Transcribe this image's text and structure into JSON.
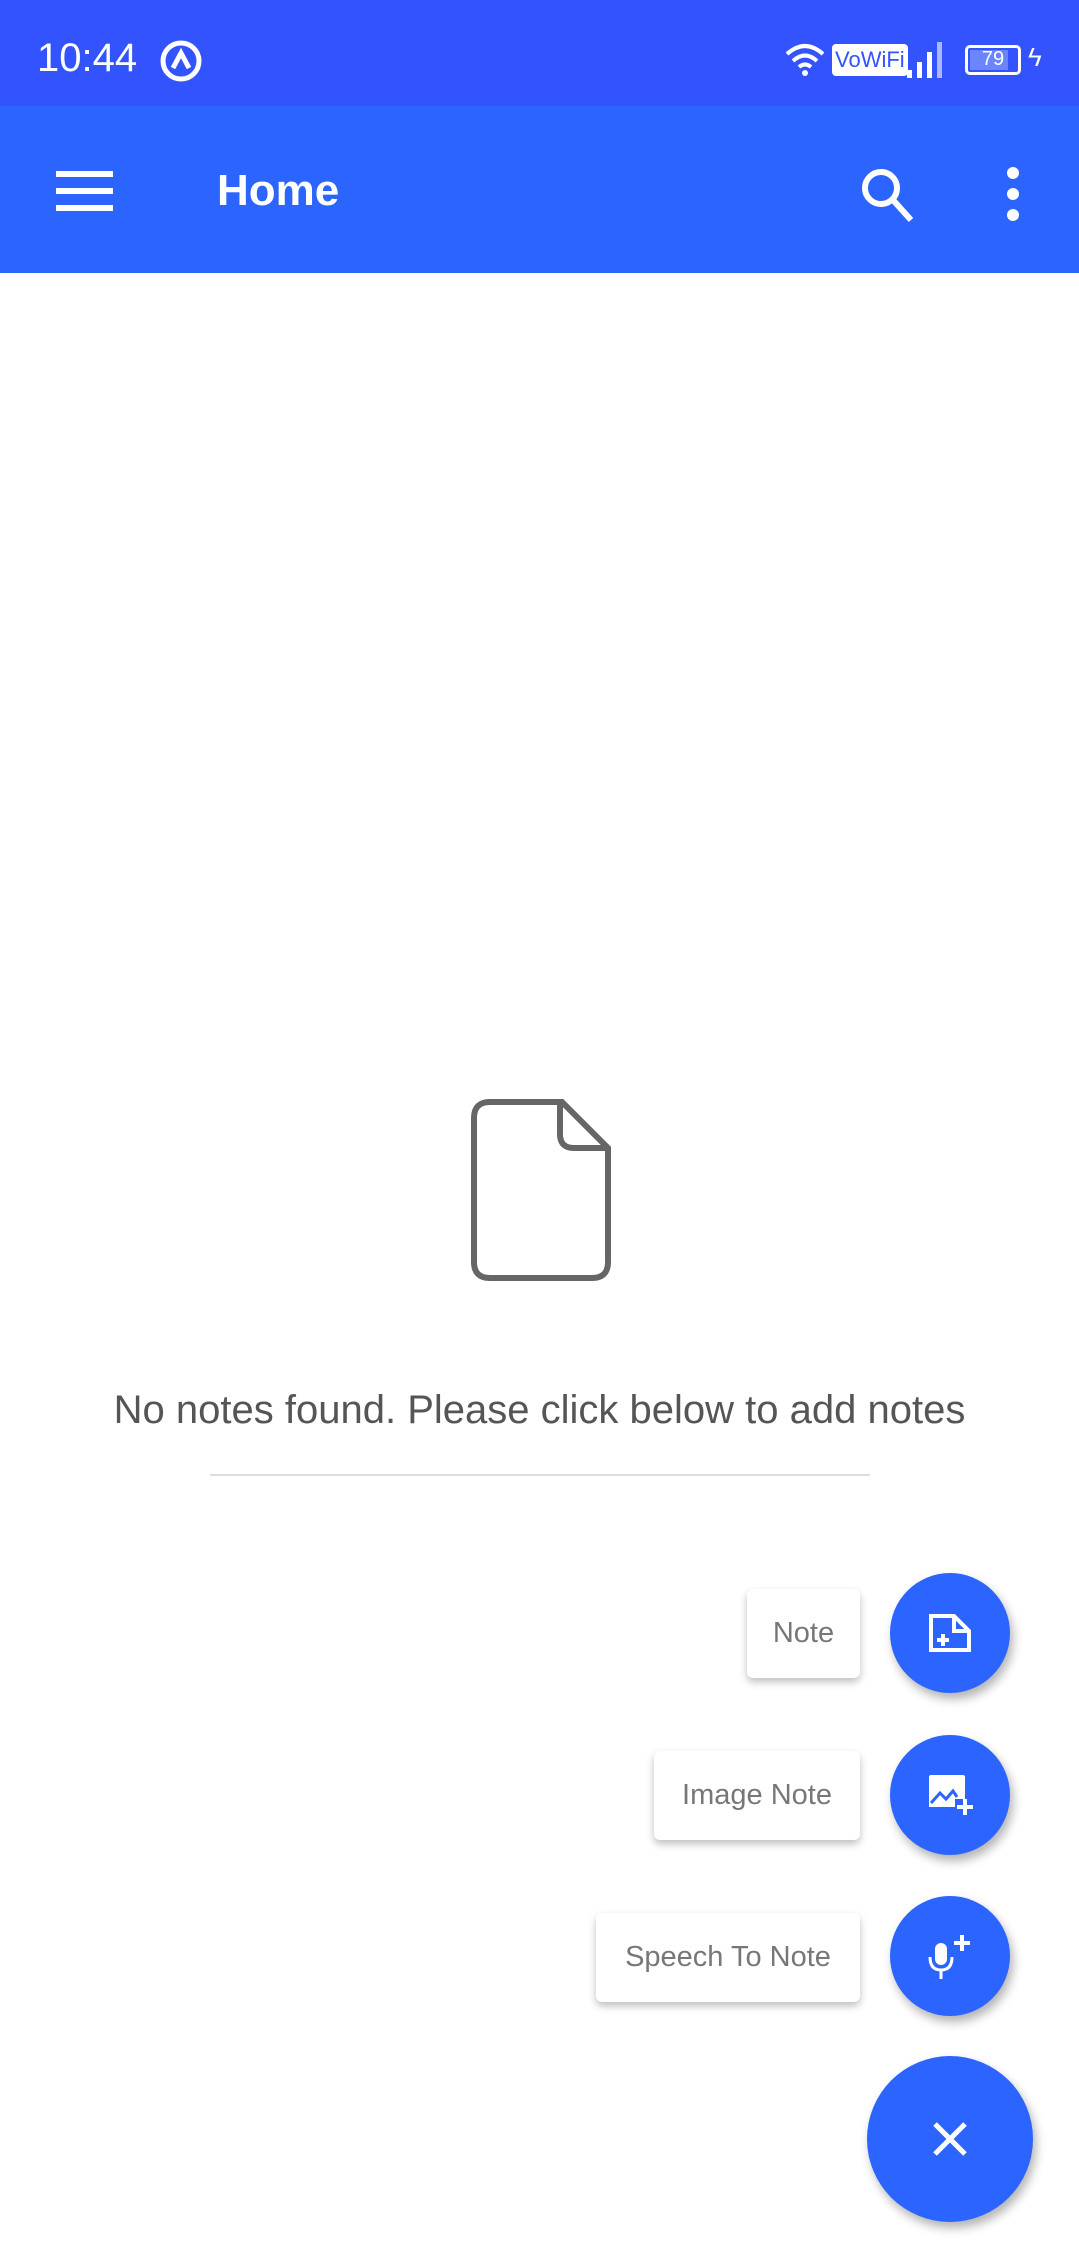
{
  "status_bar": {
    "time": "10:44",
    "vowifi": "VoWiFi",
    "battery": "79"
  },
  "app_bar": {
    "title": "Home"
  },
  "empty_state": {
    "message": "No notes found. Please click below to add notes"
  },
  "fab_menu": {
    "items": [
      {
        "label": "Note",
        "icon": "note-add-icon"
      },
      {
        "label": "Image Note",
        "icon": "image-add-icon"
      },
      {
        "label": "Speech To Note",
        "icon": "mic-add-icon"
      }
    ],
    "close_icon": "close-icon"
  },
  "colors": {
    "status_bar": "#3253fe",
    "primary": "#2c64ff"
  }
}
